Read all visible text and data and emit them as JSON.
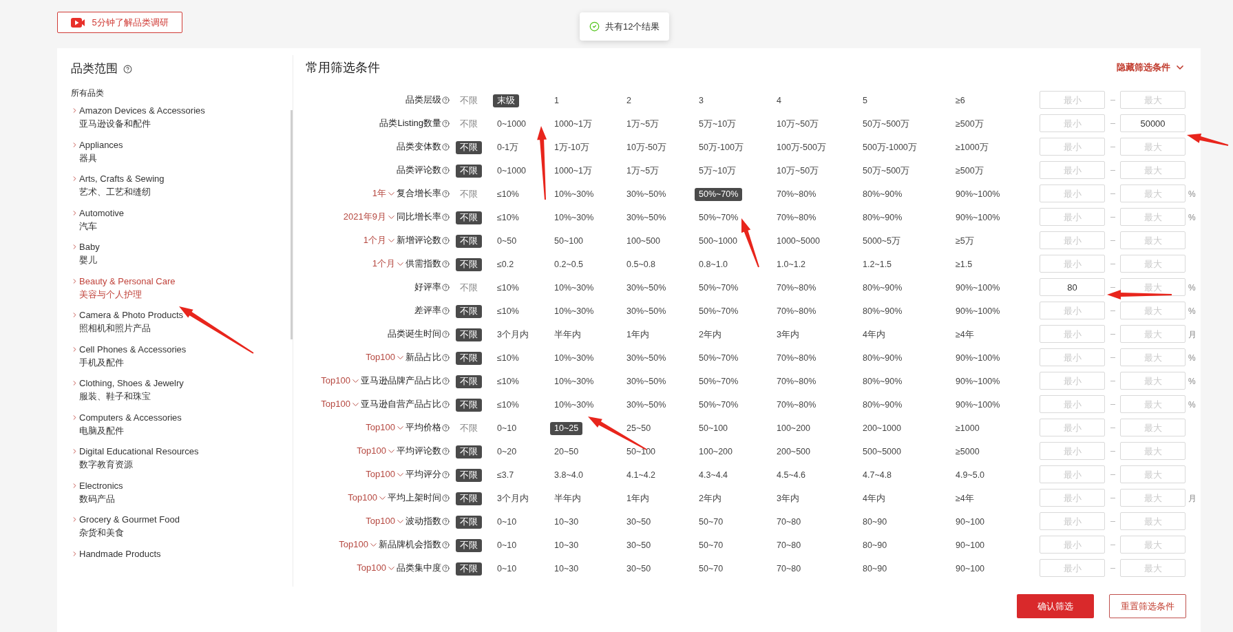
{
  "top_button": {
    "label": "5分钟了解品类调研"
  },
  "toast": {
    "text": "共有12个结果"
  },
  "sidebar": {
    "title": "品类范围",
    "all_label": "所有品类",
    "items": [
      {
        "name": "Amazon Devices & Accessories",
        "name_zh": "亚马逊设备和配件",
        "selected": false
      },
      {
        "name": "Appliances",
        "name_zh": "器具",
        "selected": false
      },
      {
        "name": "Arts, Crafts & Sewing",
        "name_zh": "艺术、工艺和缝纫",
        "selected": false
      },
      {
        "name": "Automotive",
        "name_zh": "汽车",
        "selected": false
      },
      {
        "name": "Baby",
        "name_zh": "婴儿",
        "selected": false
      },
      {
        "name": "Beauty & Personal Care",
        "name_zh": "美容与个人护理",
        "selected": true
      },
      {
        "name": "Camera & Photo Products",
        "name_zh": "照相机和照片产品",
        "selected": false
      },
      {
        "name": "Cell Phones & Accessories",
        "name_zh": "手机及配件",
        "selected": false
      },
      {
        "name": "Clothing, Shoes & Jewelry",
        "name_zh": "服装、鞋子和珠宝",
        "selected": false
      },
      {
        "name": "Computers & Accessories",
        "name_zh": "电脑及配件",
        "selected": false
      },
      {
        "name": "Digital Educational Resources",
        "name_zh": "数字教育资源",
        "selected": false
      },
      {
        "name": "Electronics",
        "name_zh": "数码产品",
        "selected": false
      },
      {
        "name": "Grocery & Gourmet Food",
        "name_zh": "杂货和美食",
        "selected": false
      },
      {
        "name": "Handmade Products",
        "selected": false
      }
    ]
  },
  "filters": {
    "title": "常用筛选条件",
    "toggle": "隐藏筛选条件",
    "rows": [
      {
        "label": "品类层级",
        "options": [
          {
            "text": "不限",
            "selected": false
          },
          {
            "text": "末级",
            "selected": true
          },
          {
            "text": "1",
            "selected": false
          },
          {
            "text": "2",
            "selected": false
          },
          {
            "text": "3",
            "selected": false
          },
          {
            "text": "4",
            "selected": false
          },
          {
            "text": "5",
            "selected": false
          },
          {
            "text": "≥6",
            "selected": false
          }
        ],
        "min": {
          "placeholder": "最小"
        },
        "max": {
          "placeholder": "最大"
        }
      },
      {
        "label": "品类Listing数量",
        "options": [
          {
            "text": "不限",
            "selected": false
          },
          {
            "text": "0~1000",
            "selected": false
          },
          {
            "text": "1000~1万",
            "selected": false
          },
          {
            "text": "1万~5万",
            "selected": false
          },
          {
            "text": "5万~10万",
            "selected": false
          },
          {
            "text": "10万~50万",
            "selected": false
          },
          {
            "text": "50万~500万",
            "selected": false
          },
          {
            "text": "≥500万",
            "selected": false
          }
        ],
        "min": {
          "placeholder": "最小"
        },
        "max": {
          "value": "50000"
        }
      },
      {
        "label": "品类变体数",
        "options": [
          {
            "text": "不限",
            "selected": true
          },
          {
            "text": "0-1万",
            "selected": false
          },
          {
            "text": "1万-10万",
            "selected": false
          },
          {
            "text": "10万-50万",
            "selected": false
          },
          {
            "text": "50万-100万",
            "selected": false
          },
          {
            "text": "100万-500万",
            "selected": false
          },
          {
            "text": "500万-1000万",
            "selected": false
          },
          {
            "text": "≥1000万",
            "selected": false
          }
        ],
        "min": {
          "placeholder": "最小"
        },
        "max": {
          "placeholder": "最大"
        }
      },
      {
        "label": "品类评论数",
        "options": [
          {
            "text": "不限",
            "selected": true
          },
          {
            "text": "0~1000",
            "selected": false
          },
          {
            "text": "1000~1万",
            "selected": false
          },
          {
            "text": "1万~5万",
            "selected": false
          },
          {
            "text": "5万~10万",
            "selected": false
          },
          {
            "text": "10万~50万",
            "selected": false
          },
          {
            "text": "50万~500万",
            "selected": false
          },
          {
            "text": "≥500万",
            "selected": false
          }
        ],
        "min": {
          "placeholder": "最小"
        },
        "max": {
          "placeholder": "最大"
        }
      },
      {
        "period": "1年",
        "label": "复合增长率",
        "options": [
          {
            "text": "不限",
            "selected": false
          },
          {
            "text": "≤10%",
            "selected": false
          },
          {
            "text": "10%~30%",
            "selected": false
          },
          {
            "text": "30%~50%",
            "selected": false
          },
          {
            "text": "50%~70%",
            "selected": true
          },
          {
            "text": "70%~80%",
            "selected": false
          },
          {
            "text": "80%~90%",
            "selected": false
          },
          {
            "text": "90%~100%",
            "selected": false
          }
        ],
        "min": {
          "placeholder": "最小"
        },
        "max": {
          "placeholder": "最大"
        },
        "unit": "%"
      },
      {
        "period": "2021年9月",
        "label": "同比增长率",
        "options": [
          {
            "text": "不限",
            "selected": true
          },
          {
            "text": "≤10%",
            "selected": false
          },
          {
            "text": "10%~30%",
            "selected": false
          },
          {
            "text": "30%~50%",
            "selected": false
          },
          {
            "text": "50%~70%",
            "selected": false
          },
          {
            "text": "70%~80%",
            "selected": false
          },
          {
            "text": "80%~90%",
            "selected": false
          },
          {
            "text": "90%~100%",
            "selected": false
          }
        ],
        "min": {
          "placeholder": "最小"
        },
        "max": {
          "placeholder": "最大"
        },
        "unit": "%"
      },
      {
        "period": "1个月",
        "label": "新增评论数",
        "options": [
          {
            "text": "不限",
            "selected": true
          },
          {
            "text": "0~50",
            "selected": false
          },
          {
            "text": "50~100",
            "selected": false
          },
          {
            "text": "100~500",
            "selected": false
          },
          {
            "text": "500~1000",
            "selected": false
          },
          {
            "text": "1000~5000",
            "selected": false
          },
          {
            "text": "5000~5万",
            "selected": false
          },
          {
            "text": "≥5万",
            "selected": false
          }
        ],
        "min": {
          "placeholder": "最小"
        },
        "max": {
          "placeholder": "最大"
        }
      },
      {
        "period": "1个月",
        "label": "供需指数",
        "options": [
          {
            "text": "不限",
            "selected": true
          },
          {
            "text": "≤0.2",
            "selected": false
          },
          {
            "text": "0.2~0.5",
            "selected": false
          },
          {
            "text": "0.5~0.8",
            "selected": false
          },
          {
            "text": "0.8~1.0",
            "selected": false
          },
          {
            "text": "1.0~1.2",
            "selected": false
          },
          {
            "text": "1.2~1.5",
            "selected": false
          },
          {
            "text": "≥1.5",
            "selected": false
          }
        ],
        "min": {
          "placeholder": "最小"
        },
        "max": {
          "placeholder": "最大"
        }
      },
      {
        "label": "好评率",
        "options": [
          {
            "text": "不限",
            "selected": false
          },
          {
            "text": "≤10%",
            "selected": false
          },
          {
            "text": "10%~30%",
            "selected": false
          },
          {
            "text": "30%~50%",
            "selected": false
          },
          {
            "text": "50%~70%",
            "selected": false
          },
          {
            "text": "70%~80%",
            "selected": false
          },
          {
            "text": "80%~90%",
            "selected": false
          },
          {
            "text": "90%~100%",
            "selected": false
          }
        ],
        "min": {
          "value": "80"
        },
        "max": {
          "placeholder": "最大"
        },
        "unit": "%"
      },
      {
        "label": "差评率",
        "options": [
          {
            "text": "不限",
            "selected": true
          },
          {
            "text": "≤10%",
            "selected": false
          },
          {
            "text": "10%~30%",
            "selected": false
          },
          {
            "text": "30%~50%",
            "selected": false
          },
          {
            "text": "50%~70%",
            "selected": false
          },
          {
            "text": "70%~80%",
            "selected": false
          },
          {
            "text": "80%~90%",
            "selected": false
          },
          {
            "text": "90%~100%",
            "selected": false
          }
        ],
        "min": {
          "placeholder": "最小"
        },
        "max": {
          "placeholder": "最大"
        },
        "unit": "%"
      },
      {
        "label": "品类诞生时间",
        "options": [
          {
            "text": "不限",
            "selected": true
          },
          {
            "text": "3个月内",
            "selected": false
          },
          {
            "text": "半年内",
            "selected": false
          },
          {
            "text": "1年内",
            "selected": false
          },
          {
            "text": "2年内",
            "selected": false
          },
          {
            "text": "3年内",
            "selected": false
          },
          {
            "text": "4年内",
            "selected": false
          },
          {
            "text": "≥4年",
            "selected": false
          }
        ],
        "min": {
          "placeholder": "最小"
        },
        "max": {
          "placeholder": "最大"
        },
        "unit": "月"
      },
      {
        "period": "Top100",
        "label": "新品占比",
        "options": [
          {
            "text": "不限",
            "selected": true
          },
          {
            "text": "≤10%",
            "selected": false
          },
          {
            "text": "10%~30%",
            "selected": false
          },
          {
            "text": "30%~50%",
            "selected": false
          },
          {
            "text": "50%~70%",
            "selected": false
          },
          {
            "text": "70%~80%",
            "selected": false
          },
          {
            "text": "80%~90%",
            "selected": false
          },
          {
            "text": "90%~100%",
            "selected": false
          }
        ],
        "min": {
          "placeholder": "最小"
        },
        "max": {
          "placeholder": "最大"
        },
        "unit": "%"
      },
      {
        "period": "Top100",
        "label": "亚马逊品牌产品占比",
        "options": [
          {
            "text": "不限",
            "selected": true
          },
          {
            "text": "≤10%",
            "selected": false
          },
          {
            "text": "10%~30%",
            "selected": false
          },
          {
            "text": "30%~50%",
            "selected": false
          },
          {
            "text": "50%~70%",
            "selected": false
          },
          {
            "text": "70%~80%",
            "selected": false
          },
          {
            "text": "80%~90%",
            "selected": false
          },
          {
            "text": "90%~100%",
            "selected": false
          }
        ],
        "min": {
          "placeholder": "最小"
        },
        "max": {
          "placeholder": "最大"
        },
        "unit": "%"
      },
      {
        "period": "Top100",
        "label": "亚马逊自营产品占比",
        "options": [
          {
            "text": "不限",
            "selected": true
          },
          {
            "text": "≤10%",
            "selected": false
          },
          {
            "text": "10%~30%",
            "selected": false
          },
          {
            "text": "30%~50%",
            "selected": false
          },
          {
            "text": "50%~70%",
            "selected": false
          },
          {
            "text": "70%~80%",
            "selected": false
          },
          {
            "text": "80%~90%",
            "selected": false
          },
          {
            "text": "90%~100%",
            "selected": false
          }
        ],
        "min": {
          "placeholder": "最小"
        },
        "max": {
          "placeholder": "最大"
        },
        "unit": "%"
      },
      {
        "period": "Top100",
        "label": "平均价格",
        "options": [
          {
            "text": "不限",
            "selected": false
          },
          {
            "text": "0~10",
            "selected": false
          },
          {
            "text": "10~25",
            "selected": true
          },
          {
            "text": "25~50",
            "selected": false
          },
          {
            "text": "50~100",
            "selected": false
          },
          {
            "text": "100~200",
            "selected": false
          },
          {
            "text": "200~1000",
            "selected": false
          },
          {
            "text": "≥1000",
            "selected": false
          }
        ],
        "min": {
          "placeholder": "最小"
        },
        "max": {
          "placeholder": "最大"
        }
      },
      {
        "period": "Top100",
        "label": "平均评论数",
        "options": [
          {
            "text": "不限",
            "selected": true
          },
          {
            "text": "0~20",
            "selected": false
          },
          {
            "text": "20~50",
            "selected": false
          },
          {
            "text": "50~100",
            "selected": false
          },
          {
            "text": "100~200",
            "selected": false
          },
          {
            "text": "200~500",
            "selected": false
          },
          {
            "text": "500~5000",
            "selected": false
          },
          {
            "text": "≥5000",
            "selected": false
          }
        ],
        "min": {
          "placeholder": "最小"
        },
        "max": {
          "placeholder": "最大"
        }
      },
      {
        "period": "Top100",
        "label": "平均评分",
        "options": [
          {
            "text": "不限",
            "selected": true
          },
          {
            "text": "≤3.7",
            "selected": false
          },
          {
            "text": "3.8~4.0",
            "selected": false
          },
          {
            "text": "4.1~4.2",
            "selected": false
          },
          {
            "text": "4.3~4.4",
            "selected": false
          },
          {
            "text": "4.5~4.6",
            "selected": false
          },
          {
            "text": "4.7~4.8",
            "selected": false
          },
          {
            "text": "4.9~5.0",
            "selected": false
          }
        ],
        "min": {
          "placeholder": "最小"
        },
        "max": {
          "placeholder": "最大"
        }
      },
      {
        "period": "Top100",
        "label": "平均上架时间",
        "options": [
          {
            "text": "不限",
            "selected": true
          },
          {
            "text": "3个月内",
            "selected": false
          },
          {
            "text": "半年内",
            "selected": false
          },
          {
            "text": "1年内",
            "selected": false
          },
          {
            "text": "2年内",
            "selected": false
          },
          {
            "text": "3年内",
            "selected": false
          },
          {
            "text": "4年内",
            "selected": false
          },
          {
            "text": "≥4年",
            "selected": false
          }
        ],
        "min": {
          "placeholder": "最小"
        },
        "max": {
          "placeholder": "最大"
        },
        "unit": "月"
      },
      {
        "period": "Top100",
        "label": "波动指数",
        "options": [
          {
            "text": "不限",
            "selected": true
          },
          {
            "text": "0~10",
            "selected": false
          },
          {
            "text": "10~30",
            "selected": false
          },
          {
            "text": "30~50",
            "selected": false
          },
          {
            "text": "50~70",
            "selected": false
          },
          {
            "text": "70~80",
            "selected": false
          },
          {
            "text": "80~90",
            "selected": false
          },
          {
            "text": "90~100",
            "selected": false
          }
        ],
        "min": {
          "placeholder": "最小"
        },
        "max": {
          "placeholder": "最大"
        }
      },
      {
        "period": "Top100",
        "label": "新品牌机会指数",
        "options": [
          {
            "text": "不限",
            "selected": true
          },
          {
            "text": "0~10",
            "selected": false
          },
          {
            "text": "10~30",
            "selected": false
          },
          {
            "text": "30~50",
            "selected": false
          },
          {
            "text": "50~70",
            "selected": false
          },
          {
            "text": "70~80",
            "selected": false
          },
          {
            "text": "80~90",
            "selected": false
          },
          {
            "text": "90~100",
            "selected": false
          }
        ],
        "min": {
          "placeholder": "最小"
        },
        "max": {
          "placeholder": "最大"
        }
      },
      {
        "period": "Top100",
        "label": "品类集中度",
        "options": [
          {
            "text": "不限",
            "selected": true
          },
          {
            "text": "0~10",
            "selected": false
          },
          {
            "text": "10~30",
            "selected": false
          },
          {
            "text": "30~50",
            "selected": false
          },
          {
            "text": "50~70",
            "selected": false
          },
          {
            "text": "70~80",
            "selected": false
          },
          {
            "text": "80~90",
            "selected": false
          },
          {
            "text": "90~100",
            "selected": false
          }
        ],
        "min": {
          "placeholder": "最小"
        },
        "max": {
          "placeholder": "最大"
        }
      }
    ]
  },
  "buttons": [
    {
      "label": "确认筛选",
      "kind": "primary"
    },
    {
      "label": "重置筛选条件",
      "kind": "secondary"
    }
  ]
}
